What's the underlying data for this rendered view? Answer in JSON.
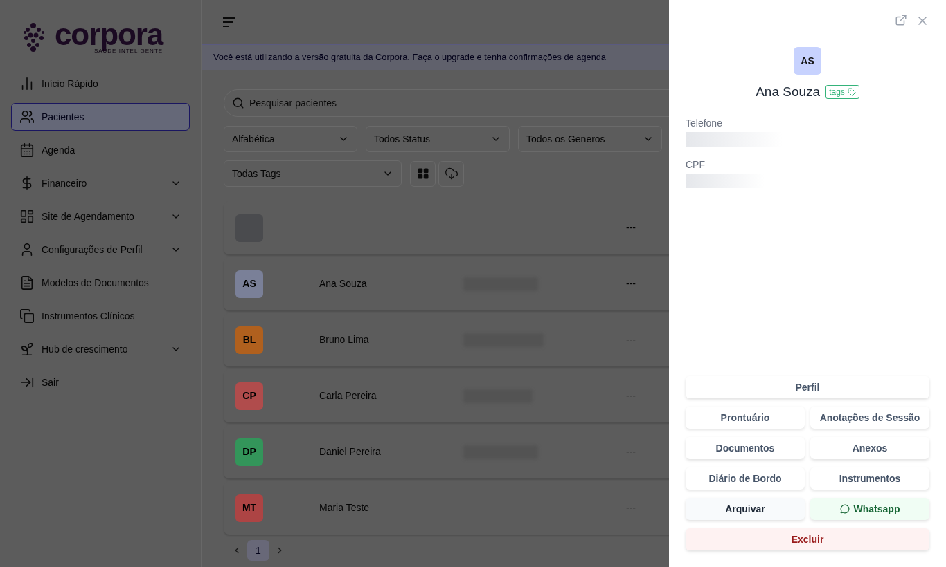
{
  "sidebar": {
    "logo": {
      "name": "corpora",
      "tagline": "SAÚDE INTELIGENTE"
    },
    "items": [
      {
        "label": "Início Rápido",
        "selected": false,
        "has_submenu": false
      },
      {
        "label": "Pacientes",
        "selected": true,
        "has_submenu": false
      },
      {
        "label": "Agenda",
        "selected": false,
        "has_submenu": false
      },
      {
        "label": "Financeiro",
        "selected": false,
        "has_submenu": true
      },
      {
        "label": "Site de Agendamento",
        "selected": false,
        "has_submenu": true
      },
      {
        "label": "Configurações de Perfil",
        "selected": false,
        "has_submenu": true
      },
      {
        "label": "Modelos de Documentos",
        "selected": false,
        "has_submenu": false
      },
      {
        "label": "Instrumentos Clínicos",
        "selected": false,
        "has_submenu": false
      },
      {
        "label": "Hub de crescimento",
        "selected": false,
        "has_submenu": true
      },
      {
        "label": "Sair",
        "selected": false,
        "has_submenu": false
      }
    ]
  },
  "banner": {
    "text": "Você está utilizando a versão gratuita da Corpora. Faça o upgrade e tenha confirmações de agenda"
  },
  "search": {
    "placeholder": "Pesquisar pacientes"
  },
  "filters": [
    {
      "value": "Alfabética"
    },
    {
      "value": "Todos Status"
    },
    {
      "value": "Todos os Generos"
    },
    {
      "value": "Todas Tags"
    }
  ],
  "patients": [
    {
      "color": "#4a4b4e",
      "status": "---"
    },
    {
      "initials": "AS",
      "name": "Ana Souza",
      "color": "#7a8098",
      "status": "---"
    },
    {
      "initials": "BL",
      "name": "Bruno Lima",
      "color": "#b0601e",
      "status": "---"
    },
    {
      "initials": "CP",
      "name": "Carla Pereira",
      "color": "#b04c4c",
      "status": "---"
    },
    {
      "initials": "DP",
      "name": "Daniel Pereira",
      "color": "#33955a",
      "status": "---"
    },
    {
      "initials": "MT",
      "name": "Maria Teste",
      "color": "#ad4444",
      "status": "---"
    }
  ],
  "pagination": {
    "pages": [
      {
        "label": "1",
        "selected": true
      }
    ]
  },
  "drawer": {
    "initials": "AS",
    "name": "Ana Souza",
    "tag": "tags",
    "fields": [
      {
        "label": "Telefone"
      },
      {
        "label": "CPF"
      }
    ],
    "actions": [
      {
        "label": "Perfil",
        "kind": "default",
        "wide": true
      },
      {
        "label": "Prontuário",
        "kind": "default",
        "wide": false
      },
      {
        "label": "Anotações de Sessão",
        "kind": "default",
        "wide": false
      },
      {
        "label": "Documentos",
        "kind": "default",
        "wide": false
      },
      {
        "label": "Anexos",
        "kind": "default",
        "wide": false
      },
      {
        "label": "Diário de Bordo",
        "kind": "default",
        "wide": false
      },
      {
        "label": "Instrumentos",
        "kind": "default",
        "wide": false
      },
      {
        "label": "Arquivar",
        "kind": "archive",
        "wide": false
      },
      {
        "label": "Whatsapp",
        "kind": "whatsapp",
        "wide": false
      },
      {
        "label": "Excluir",
        "kind": "danger",
        "wide": true
      }
    ]
  }
}
